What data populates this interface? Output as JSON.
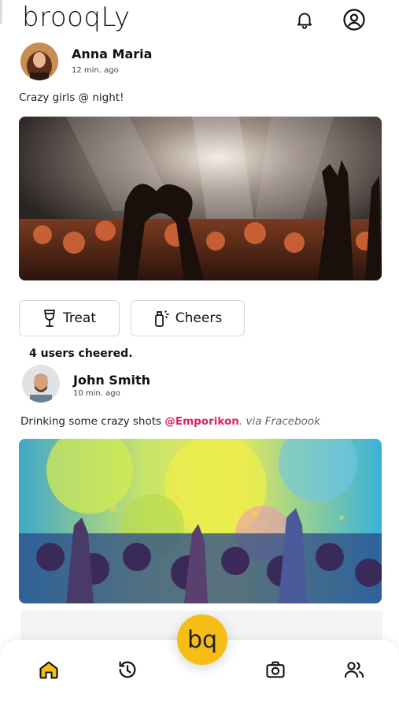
{
  "app": {
    "logo": "brooqLy"
  },
  "header": {
    "bell_icon": "bell-icon",
    "account_icon": "account-circle-icon"
  },
  "posts": [
    {
      "author": "Anna Maria",
      "time": "12 min. ago",
      "caption": "Crazy girls @ night!",
      "actions": {
        "treat_label": "Treat",
        "cheers_label": "Cheers"
      },
      "cheer_count": "4 users cheered."
    },
    {
      "author": "John Smith",
      "time": "10 min. ago",
      "caption_text": "Drinking some crazy shots ",
      "mention": "@Emporikon",
      "via": ". via Fracebook"
    }
  ],
  "fab": {
    "label": "bq"
  },
  "nav": {
    "items": [
      "home-icon",
      "history-icon",
      "camera-icon",
      "users-icon"
    ],
    "active": "home-icon"
  },
  "colors": {
    "accent": "#f7bd17",
    "mention": "#e0245e"
  }
}
